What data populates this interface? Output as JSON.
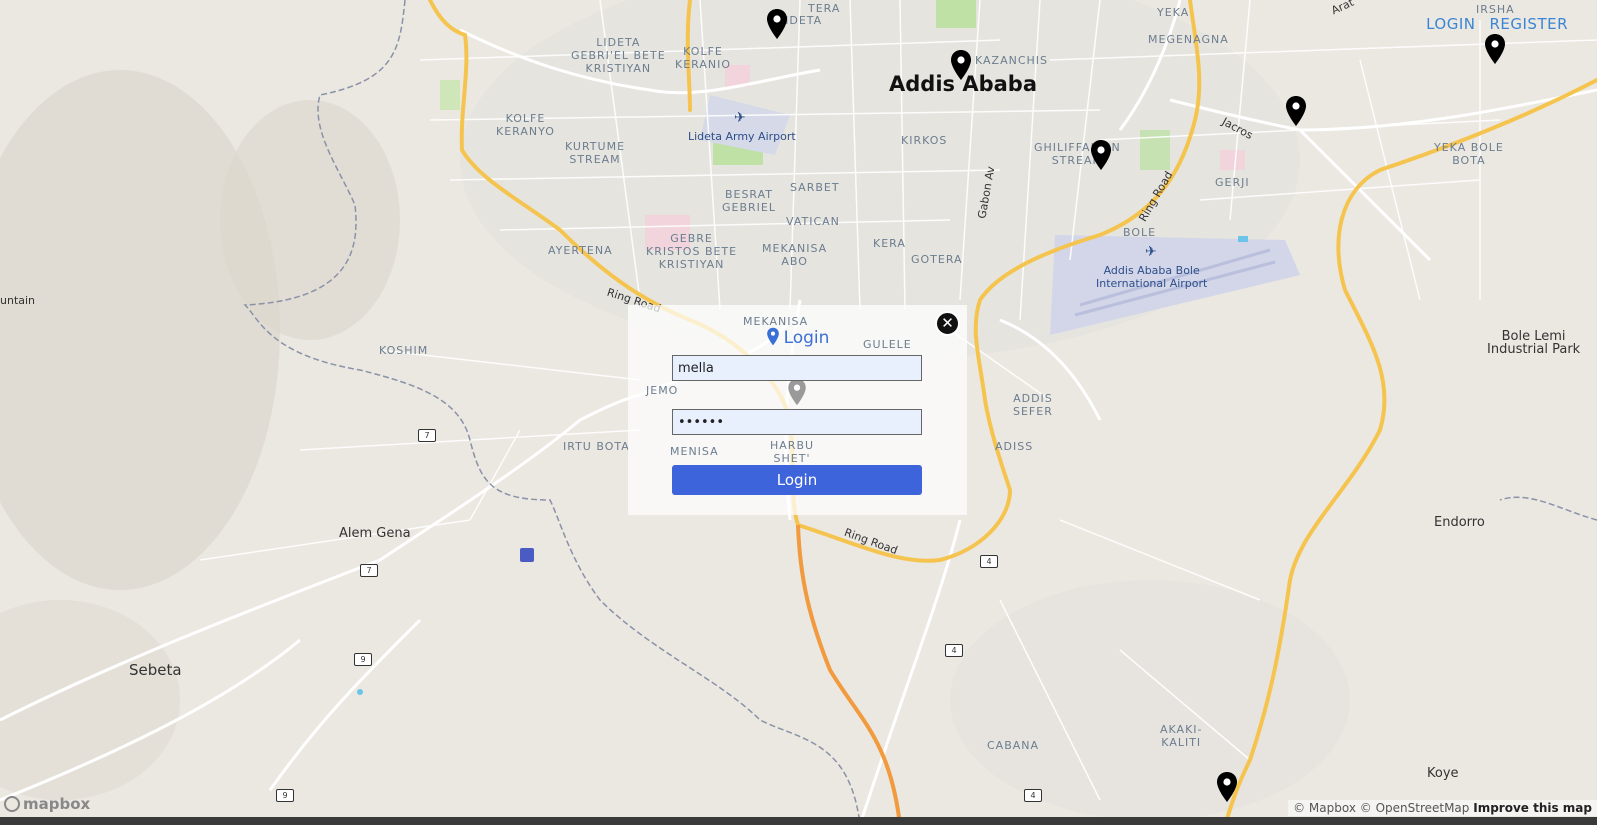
{
  "nav": {
    "login": "LOGIN",
    "register": "REGISTER"
  },
  "modal": {
    "title": "Login",
    "username_value": "mella",
    "password_value": "••••••",
    "submit_label": "Login",
    "close_glyph": "✕"
  },
  "map": {
    "labels": {
      "addis_ababa": "Addis Ababa",
      "lideta": "LIDETA",
      "tera": "TERA",
      "yeka": "YEKA",
      "irsha": "IRSHA",
      "megenagna": "MEGENAGNA",
      "kazanchis": "KAZANCHIS",
      "kirkos": "KIRKOS",
      "lideta_gebri": "LIDETA\nGEBRI'EL BETE\nKRISTIYAN",
      "kolfe_keranio": "KOLFE\nKERANIO",
      "kolfe_keranyo": "KOLFE\nKERANYO",
      "kurtume": "KURTUME\nSTREAM",
      "besrat": "BESRAT\nGEBRIEL",
      "sarbet": "SARBET",
      "vatican": "VATICAN",
      "gebre": "GEBRE\nKRISTOS BETE\nKRISTIYAN",
      "mekanisa_abo": "MEKANISA\nABO",
      "kera": "KERA",
      "gotera": "GOTERA",
      "ayertena": "AYERTENA",
      "ghiliffalign": "GHILIFFALIGN\nSTREAM",
      "gerji": "GERJI",
      "bole": "BOLE",
      "yeka_bole": "YEKA BOLE\nBOTA",
      "bole_lemi": "Bole Lemi\nIndustrial Park",
      "lideta_airport": "Lideta Army Airport",
      "bole_airport": "Addis Ababa Bole\nInternational Airport",
      "koshim": "KOSHIM",
      "irtu_bota": "IRTU BOTA",
      "mekanisa": "MEKANISA",
      "gulele": "GULELE",
      "jemo": "JEMO",
      "menisa": "MENISA",
      "harbu": "HARBU\nSHET'",
      "addis_sefer": "ADDIS\nSEFER",
      "adiss": "ADISS",
      "alem_gena": "Alem Gena",
      "sebeta": "Sebeta",
      "endorro": "Endorro",
      "cabana": "CABANA",
      "akaki": "AKAKI-\nKALITI",
      "koye": "Koye",
      "untain": "untain",
      "ring_road_1": "Ring Road",
      "ring_road_2": "Ring Road",
      "ring_road_3": "Ring Road",
      "jacros": "Jacros",
      "gabon": "Gabon Av",
      "arat": "Arat"
    },
    "shields": {
      "s7a": "7",
      "s7b": "7",
      "s9a": "9",
      "s9b": "9",
      "s4a": "4",
      "s4b": "4",
      "s4c": "4"
    }
  },
  "footer": {
    "mapbox_logo": "mapbox",
    "attribution": "© Mapbox © OpenStreetMap",
    "improve": "Improve this map"
  },
  "colors": {
    "accent": "#3e64db",
    "link": "#3a86d6",
    "major_road": "#f5c44e",
    "map_bg": "#ebe7e1"
  }
}
